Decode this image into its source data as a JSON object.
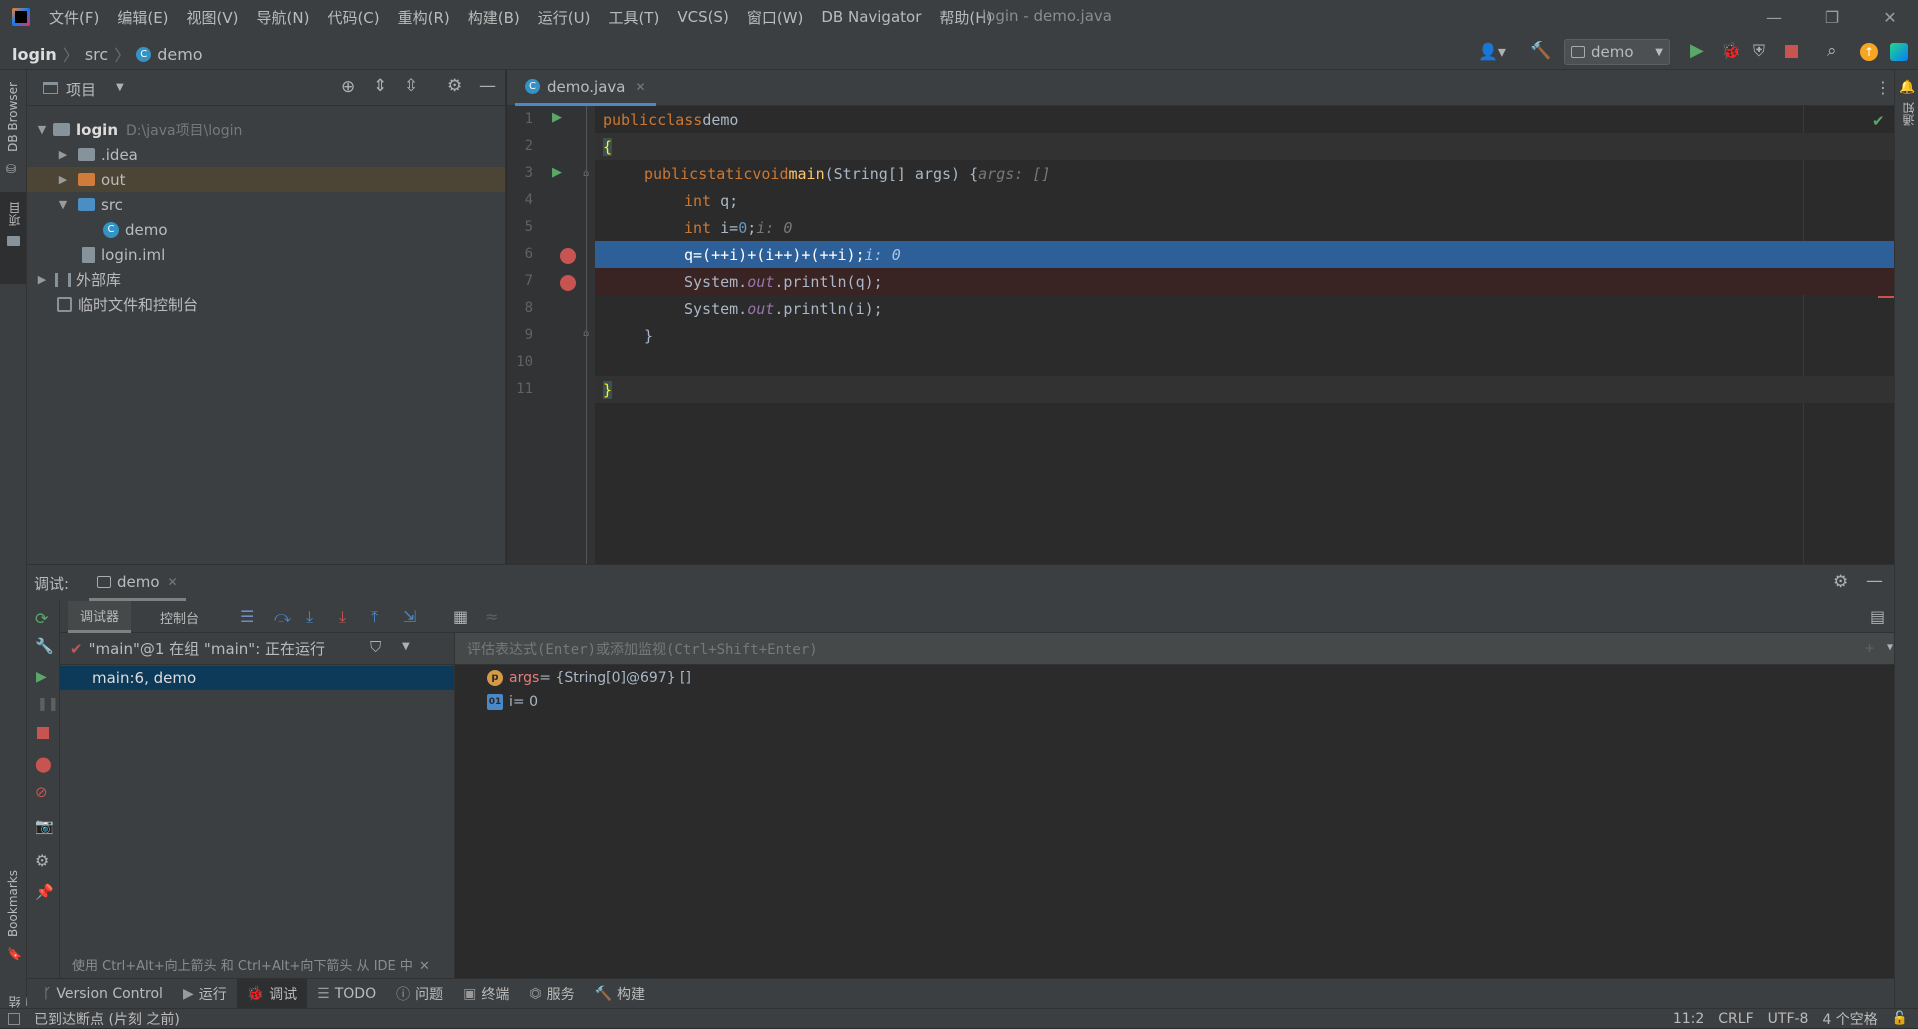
{
  "titlebar": {
    "menu": [
      "文件(F)",
      "编辑(E)",
      "视图(V)",
      "导航(N)",
      "代码(C)",
      "重构(R)",
      "构建(B)",
      "运行(U)",
      "工具(T)",
      "VCS(S)",
      "窗口(W)",
      "DB Navigator",
      "帮助(H)"
    ],
    "title": "login - demo.java"
  },
  "navbar": {
    "breadcrumb": [
      "login",
      "src",
      "demo"
    ],
    "run_config": "demo"
  },
  "leftstrip": {
    "db_browser": "DB Browser",
    "project": "项目",
    "bookmarks": "Bookmarks",
    "structure": "结构"
  },
  "rightstrip": {
    "notifications": "通知"
  },
  "project": {
    "header_title": "项目",
    "tree": [
      {
        "label": "login",
        "hint": "D:\\java项目\\login"
      },
      {
        "label": ".idea"
      },
      {
        "label": "out"
      },
      {
        "label": "src"
      },
      {
        "label": "demo"
      },
      {
        "label": "login.iml"
      },
      {
        "label": "外部库"
      },
      {
        "label": "临时文件和控制台"
      }
    ]
  },
  "editor": {
    "tab": "demo.java",
    "line_numbers": [
      "1",
      "2",
      "3",
      "4",
      "5",
      "6",
      "7",
      "8",
      "9",
      "10",
      "11"
    ],
    "lines": {
      "l1": {
        "kw1": "public",
        "kw2": "class",
        "name": "demo"
      },
      "l2": {
        "brace": "{"
      },
      "l3": {
        "kw1": "public",
        "kw2": "static",
        "kw3": "void",
        "fn": "main",
        "rest": "(String[] args) {",
        "hint": "args: []"
      },
      "l4": {
        "kw": "int",
        "rest": " q;"
      },
      "l5": {
        "kw": "int",
        "rest": " i=",
        "num": "0",
        "end": ";",
        "hint": "i: 0"
      },
      "l6": {
        "code": "q=(++i)+(i++)+(++i);",
        "hint": "i: 0"
      },
      "l7": {
        "pre": "System.",
        "st": "out",
        "post": ".println(q);"
      },
      "l8": {
        "pre": "System.",
        "st": "out",
        "post": ".println(i);"
      },
      "l9": {
        "brace": "}"
      },
      "l11": {
        "brace": "}"
      }
    }
  },
  "debug": {
    "label": "调试:",
    "tab": "demo",
    "debugger_tab": "调试器",
    "console_tab": "控制台",
    "thread": "\"main\"@1 在组 \"main\": 正在运行",
    "frame": "main:6, demo",
    "eval_placeholder": "评估表达式(Enter)或添加监视(Ctrl+Shift+Enter)",
    "vars": [
      {
        "name": "args",
        "value": " = {String[0]@697} []",
        "icon": "p"
      },
      {
        "name": "i",
        "value": " = 0",
        "icon": "01"
      }
    ],
    "hint_text": "使用 Ctrl+Alt+向上箭头 和 Ctrl+Alt+向下箭头 从 IDE 中"
  },
  "bottombar": {
    "tabs": [
      "Version Control",
      "运行",
      "调试",
      "TODO",
      "问题",
      "终端",
      "服务",
      "构建"
    ]
  },
  "status": {
    "message": "已到达断点 (片刻 之前)",
    "position": "11:2",
    "line_sep": "CRLF",
    "encoding": "UTF-8",
    "indent": "4 个空格"
  },
  "colors": {
    "accent": "#4a88c7",
    "selection": "#2d6099",
    "breakpoint": "#c75450"
  }
}
